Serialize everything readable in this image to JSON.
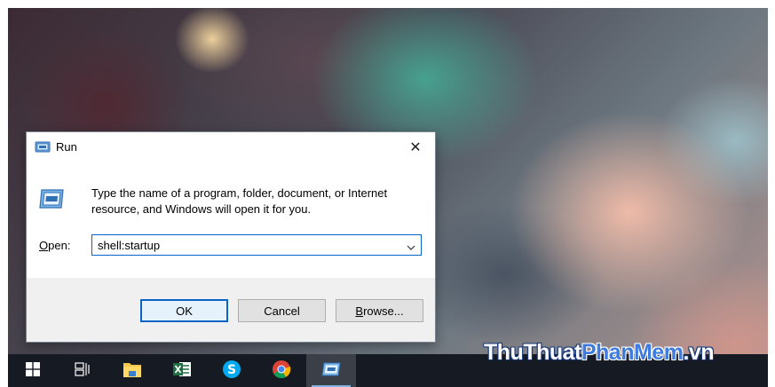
{
  "dialog": {
    "title": "Run",
    "description_line1": "Type the name of a program, folder, document, or Internet",
    "description_line2": "resource, and Windows will open it for you.",
    "open_label_mnemonic": "O",
    "open_label_rest": "pen:",
    "open_value": "shell:startup",
    "buttons": {
      "ok": "OK",
      "cancel": "Cancel",
      "browse_mnemonic": "B",
      "browse_rest": "rowse..."
    },
    "close_glyph": "✕"
  },
  "taskbar": {
    "items": [
      {
        "name": "start",
        "icon": "windows-logo-icon"
      },
      {
        "name": "task-view",
        "icon": "task-view-icon"
      },
      {
        "name": "file-explorer",
        "icon": "folder-icon"
      },
      {
        "name": "excel",
        "icon": "excel-icon"
      },
      {
        "name": "skype",
        "icon": "skype-icon"
      },
      {
        "name": "chrome",
        "icon": "chrome-icon"
      },
      {
        "name": "run",
        "icon": "run-icon",
        "active": true
      }
    ]
  },
  "watermark": {
    "part1": "ThuThuat",
    "part2": "PhanMem",
    "part3": ".vn"
  },
  "colors": {
    "accent": "#0a64c8",
    "taskbar": "#161a22"
  }
}
